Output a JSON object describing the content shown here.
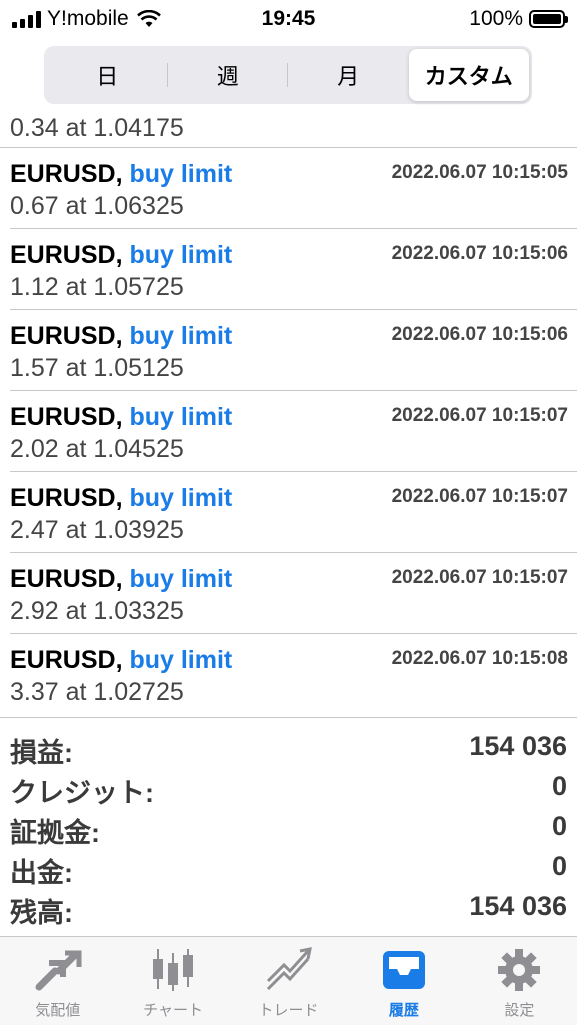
{
  "status_bar": {
    "carrier": "Y!mobile",
    "time": "19:45",
    "battery": "100%"
  },
  "segment": {
    "tabs": [
      "日",
      "週",
      "月",
      "カスタム"
    ],
    "active": "カスタム"
  },
  "partial_row": {
    "detail": "0.34 at 1.04175"
  },
  "orders": [
    {
      "symbol": "EURUSD,",
      "type": "buy limit",
      "time": "2022.06.07 10:15:05",
      "detail": "0.67 at 1.06325"
    },
    {
      "symbol": "EURUSD,",
      "type": "buy limit",
      "time": "2022.06.07 10:15:06",
      "detail": "1.12 at 1.05725"
    },
    {
      "symbol": "EURUSD,",
      "type": "buy limit",
      "time": "2022.06.07 10:15:06",
      "detail": "1.57 at 1.05125"
    },
    {
      "symbol": "EURUSD,",
      "type": "buy limit",
      "time": "2022.06.07 10:15:07",
      "detail": "2.02 at 1.04525"
    },
    {
      "symbol": "EURUSD,",
      "type": "buy limit",
      "time": "2022.06.07 10:15:07",
      "detail": "2.47 at 1.03925"
    },
    {
      "symbol": "EURUSD,",
      "type": "buy limit",
      "time": "2022.06.07 10:15:07",
      "detail": "2.92 at 1.03325"
    },
    {
      "symbol": "EURUSD,",
      "type": "buy limit",
      "time": "2022.06.07 10:15:08",
      "detail": "3.37 at 1.02725"
    }
  ],
  "summary": [
    {
      "label": "損益:",
      "value": "154 036"
    },
    {
      "label": "クレジット:",
      "value": "0"
    },
    {
      "label": "証拠金:",
      "value": "0"
    },
    {
      "label": "出金:",
      "value": "0"
    },
    {
      "label": "残高:",
      "value": "154 036"
    }
  ],
  "tabbar": {
    "items": [
      {
        "label": "気配値",
        "icon": "quotes-icon"
      },
      {
        "label": "チャート",
        "icon": "chart-icon"
      },
      {
        "label": "トレード",
        "icon": "trade-icon"
      },
      {
        "label": "履歴",
        "icon": "history-icon"
      },
      {
        "label": "設定",
        "icon": "settings-icon"
      }
    ],
    "active": "履歴"
  },
  "colors": {
    "accent": "#1a7ce6",
    "inactive_icon": "#8e8e93"
  }
}
